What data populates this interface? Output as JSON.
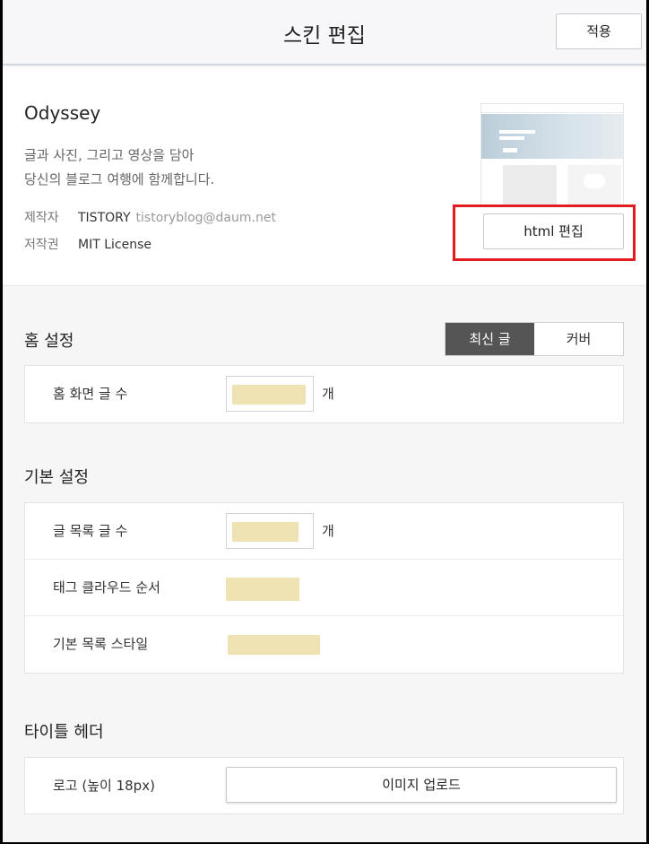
{
  "header": {
    "title": "스킨 편집",
    "apply_label": "적용"
  },
  "skin": {
    "name": "Odyssey",
    "description_line1": "글과 사진, 그리고 영상을 담아",
    "description_line2": "당신의 블로그 여행에 함께합니다.",
    "author_label": "제작자",
    "author_name": "TISTORY",
    "author_email": "tistoryblog@daum.net",
    "license_label": "저작권",
    "license_value": "MIT License",
    "html_edit_label": "html 편집"
  },
  "home_settings": {
    "title": "홈 설정",
    "segments": [
      {
        "label": "최신 글",
        "active": true
      },
      {
        "label": "커버",
        "active": false
      }
    ],
    "post_count_label": "홈 화면 글 수",
    "post_count_unit": "개"
  },
  "basic_settings": {
    "title": "기본 설정",
    "list_count_label": "글 목록 글 수",
    "list_count_unit": "개",
    "tag_cloud_label": "태그 클라우드 순서",
    "list_style_label": "기본 목록 스타일"
  },
  "title_header": {
    "title": "타이틀 헤더",
    "logo_label": "로고 (높이 18px)",
    "upload_label": "이미지 업로드"
  },
  "colors": {
    "highlight_border": "#e21c23",
    "field_fill": "#efe3b4",
    "segment_active": "#555555"
  }
}
